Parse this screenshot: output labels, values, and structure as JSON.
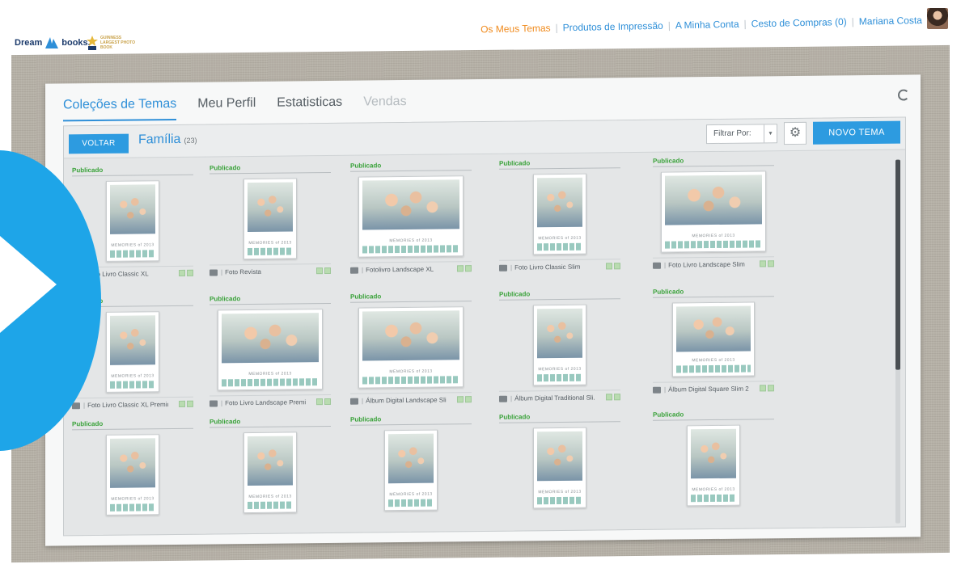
{
  "header": {
    "logo_dream": "Dream",
    "logo_books": "books.",
    "guinness_text": "GUINNESS LARGEST PHOTO BOOK",
    "nav": [
      {
        "label": "Os Meus Temas",
        "active": true
      },
      {
        "label": "Produtos de Impressão",
        "active": false
      },
      {
        "label": "A Minha Conta",
        "active": false
      },
      {
        "label": "Cesto de Compras (0)",
        "active": false
      },
      {
        "label": "Mariana Costa",
        "active": false
      }
    ]
  },
  "tabs": [
    {
      "label": "Coleções de Temas",
      "state": "active"
    },
    {
      "label": "Meu Perfil",
      "state": "normal"
    },
    {
      "label": "Estatisticas",
      "state": "normal"
    },
    {
      "label": "Vendas",
      "state": "disabled"
    }
  ],
  "toolbar": {
    "back_label": "VOLTAR",
    "collection_title": "Família",
    "collection_count": "(23)",
    "filter_label": "Filtrar Por:",
    "new_theme_label": "NOVO TEMA"
  },
  "items": [
    {
      "status": "Publicado",
      "label": "Foto Livro Classic XL",
      "shape": "portrait"
    },
    {
      "status": "Publicado",
      "label": "Foto Revista",
      "shape": "portrait"
    },
    {
      "status": "Publicado",
      "label": "Fotolivro Landscape XL",
      "shape": "landscape"
    },
    {
      "status": "Publicado",
      "label": "Foto Livro Classic Slim",
      "shape": "portrait"
    },
    {
      "status": "Publicado",
      "label": "Foto Livro Landscape Slim",
      "shape": "landscape"
    },
    {
      "status": "Publicado",
      "label": "Foto Livro Classic XL Premium",
      "shape": "portrait"
    },
    {
      "status": "Publicado",
      "label": "Foto Livro Landscape Premi...",
      "shape": "landscape"
    },
    {
      "status": "Publicado",
      "label": "Álbum Digital Landscape Sli...",
      "shape": "landscape"
    },
    {
      "status": "Publicado",
      "label": "Álbum Digital Traditional Sli...",
      "shape": "portrait"
    },
    {
      "status": "Publicado",
      "label": "Álbum Digital Square Slim 21...",
      "shape": "square"
    },
    {
      "status": "Publicado",
      "label": "",
      "shape": "portrait"
    },
    {
      "status": "Publicado",
      "label": "",
      "shape": "portrait"
    },
    {
      "status": "Publicado",
      "label": "",
      "shape": "portrait"
    },
    {
      "status": "Publicado",
      "label": "",
      "shape": "portrait"
    },
    {
      "status": "Publicado",
      "label": "",
      "shape": "portrait"
    }
  ],
  "thumb_caption": "MEMORIES of 2013",
  "colors": {
    "accent": "#1ea5e8",
    "primary_button": "#2d9be0",
    "link": "#2e8fd8",
    "active_nav": "#f08a1c",
    "status_green": "#3aa23a"
  }
}
